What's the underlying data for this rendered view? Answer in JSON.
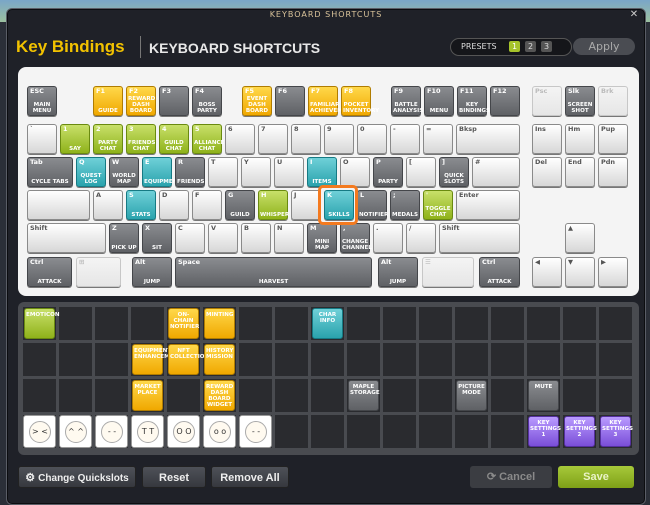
{
  "window": {
    "title": "KEYBOARD SHORTCUTS",
    "close": "✕"
  },
  "header": {
    "key_bindings": "Key Bindings",
    "keyboard_shortcuts": "KEYBOARD SHORTCUTS",
    "presets_label": "PRESETS",
    "presets": [
      "1",
      "2",
      "3"
    ],
    "active_preset": "1",
    "apply": "Apply"
  },
  "keys": [
    {
      "id": "esc",
      "label": "ESC",
      "action": "MAIN MENU",
      "color": "dark"
    },
    {
      "id": "f1",
      "label": "F1",
      "action": "GUIDE",
      "color": "yellow"
    },
    {
      "id": "f2",
      "label": "F2",
      "action": "REWARD DASH BOARD",
      "color": "yellow"
    },
    {
      "id": "f3",
      "label": "F3",
      "action": "",
      "color": "dark"
    },
    {
      "id": "f4",
      "label": "F4",
      "action": "BOSS PARTY",
      "color": "dark"
    },
    {
      "id": "f5",
      "label": "F5",
      "action": "EVENT DASH BOARD",
      "color": "yellow"
    },
    {
      "id": "f6",
      "label": "F6",
      "action": "",
      "color": "dark"
    },
    {
      "id": "f7",
      "label": "F7",
      "action": "FAMILIAR ACHIEVEMENT",
      "color": "yellow"
    },
    {
      "id": "f8",
      "label": "F8",
      "action": "POCKET INVENTORY",
      "color": "yellow"
    },
    {
      "id": "f9",
      "label": "F9",
      "action": "BATTLE ANALYSIS",
      "color": "dark"
    },
    {
      "id": "f10",
      "label": "F10",
      "action": "MENU",
      "color": "dark"
    },
    {
      "id": "f11",
      "label": "F11",
      "action": "KEY BINDINGS",
      "color": "dark"
    },
    {
      "id": "f12",
      "label": "F12",
      "action": "",
      "color": "dark"
    },
    {
      "id": "psc",
      "label": "Psc",
      "action": "",
      "color": "dimmed"
    },
    {
      "id": "slk",
      "label": "Slk",
      "action": "SCREEN SHOT",
      "color": "dark"
    },
    {
      "id": "brk",
      "label": "Brk",
      "action": "",
      "color": "dimmed"
    },
    {
      "id": "grave",
      "label": "`",
      "action": "",
      "color": "white"
    },
    {
      "id": "1",
      "label": "1",
      "action": "SAY",
      "color": "green"
    },
    {
      "id": "2",
      "label": "2",
      "action": "PARTY CHAT",
      "color": "green"
    },
    {
      "id": "3",
      "label": "3",
      "action": "FRIENDS CHAT",
      "color": "green"
    },
    {
      "id": "4",
      "label": "4",
      "action": "GUILD CHAT",
      "color": "green"
    },
    {
      "id": "5",
      "label": "5",
      "action": "ALLIANCE CHAT",
      "color": "green"
    },
    {
      "id": "6",
      "label": "6",
      "action": "",
      "color": "white"
    },
    {
      "id": "7",
      "label": "7",
      "action": "",
      "color": "white"
    },
    {
      "id": "8",
      "label": "8",
      "action": "",
      "color": "white"
    },
    {
      "id": "9",
      "label": "9",
      "action": "",
      "color": "white"
    },
    {
      "id": "0",
      "label": "0",
      "action": "",
      "color": "white"
    },
    {
      "id": "minus",
      "label": "-",
      "action": "",
      "color": "white"
    },
    {
      "id": "equal",
      "label": "=",
      "action": "",
      "color": "white"
    },
    {
      "id": "bksp",
      "label": "Bksp",
      "action": "",
      "color": "white"
    },
    {
      "id": "ins",
      "label": "Ins",
      "action": "",
      "color": "white"
    },
    {
      "id": "hm",
      "label": "Hm",
      "action": "",
      "color": "white"
    },
    {
      "id": "pup",
      "label": "Pup",
      "action": "",
      "color": "white"
    },
    {
      "id": "tab",
      "label": "Tab",
      "action": "CYCLE TABS",
      "color": "dark"
    },
    {
      "id": "q",
      "label": "Q",
      "action": "QUEST LOG",
      "color": "teal"
    },
    {
      "id": "w",
      "label": "W",
      "action": "WORLD MAP",
      "color": "dark"
    },
    {
      "id": "e",
      "label": "E",
      "action": "EQUIPMENT",
      "color": "teal"
    },
    {
      "id": "r",
      "label": "R",
      "action": "FRIENDS",
      "color": "dark"
    },
    {
      "id": "t",
      "label": "T",
      "action": "",
      "color": "white"
    },
    {
      "id": "y",
      "label": "Y",
      "action": "",
      "color": "white"
    },
    {
      "id": "u",
      "label": "U",
      "action": "",
      "color": "white"
    },
    {
      "id": "i",
      "label": "I",
      "action": "ITEMS",
      "color": "teal"
    },
    {
      "id": "o",
      "label": "O",
      "action": "",
      "color": "white"
    },
    {
      "id": "p",
      "label": "P",
      "action": "PARTY",
      "color": "dark"
    },
    {
      "id": "lbr",
      "label": "[",
      "action": "",
      "color": "white"
    },
    {
      "id": "rbr",
      "label": "]",
      "action": "QUICK SLOTS",
      "color": "dark"
    },
    {
      "id": "bsl",
      "label": "#",
      "action": "",
      "color": "white"
    },
    {
      "id": "del",
      "label": "Del",
      "action": "",
      "color": "white"
    },
    {
      "id": "end",
      "label": "End",
      "action": "",
      "color": "white"
    },
    {
      "id": "pdn",
      "label": "Pdn",
      "action": "",
      "color": "white"
    },
    {
      "id": "caps",
      "label": "",
      "action": "",
      "color": "white"
    },
    {
      "id": "a",
      "label": "A",
      "action": "",
      "color": "white"
    },
    {
      "id": "s",
      "label": "S",
      "action": "STATS",
      "color": "teal"
    },
    {
      "id": "d",
      "label": "D",
      "action": "",
      "color": "white"
    },
    {
      "id": "f",
      "label": "F",
      "action": "",
      "color": "white"
    },
    {
      "id": "g",
      "label": "G",
      "action": "GUILD",
      "color": "dark"
    },
    {
      "id": "h",
      "label": "H",
      "action": "WHISPER",
      "color": "green"
    },
    {
      "id": "j",
      "label": "J",
      "action": "",
      "color": "white"
    },
    {
      "id": "k",
      "label": "K",
      "action": "SKILLS",
      "color": "teal"
    },
    {
      "id": "l",
      "label": "L",
      "action": "NOTIFIER",
      "color": "dark"
    },
    {
      "id": "semi",
      "label": ";",
      "action": "MEDALS",
      "color": "dark"
    },
    {
      "id": "quote",
      "label": "'",
      "action": "TOGGLE CHAT",
      "color": "green"
    },
    {
      "id": "enter",
      "label": "Enter",
      "action": "",
      "color": "white"
    },
    {
      "id": "lshift",
      "label": "Shift",
      "action": "",
      "color": "white"
    },
    {
      "id": "z",
      "label": "Z",
      "action": "PICK UP",
      "color": "dark"
    },
    {
      "id": "x",
      "label": "X",
      "action": "SIT",
      "color": "dark"
    },
    {
      "id": "c",
      "label": "C",
      "action": "",
      "color": "white"
    },
    {
      "id": "v",
      "label": "V",
      "action": "",
      "color": "white"
    },
    {
      "id": "b",
      "label": "B",
      "action": "",
      "color": "white"
    },
    {
      "id": "n",
      "label": "N",
      "action": "",
      "color": "white"
    },
    {
      "id": "m",
      "label": "M",
      "action": "MINI MAP",
      "color": "dark"
    },
    {
      "id": "comma",
      "label": ",",
      "action": "CHANGE CHANNEL",
      "color": "dark"
    },
    {
      "id": "period",
      "label": ".",
      "action": "",
      "color": "white"
    },
    {
      "id": "slash",
      "label": "/",
      "action": "",
      "color": "white"
    },
    {
      "id": "rshift",
      "label": "Shift",
      "action": "",
      "color": "white"
    },
    {
      "id": "up",
      "label": "▲",
      "action": "",
      "color": "white"
    },
    {
      "id": "lctrl",
      "label": "Ctrl",
      "action": "ATTACK",
      "color": "dark"
    },
    {
      "id": "win",
      "label": "⊞",
      "action": "",
      "color": "dimmed"
    },
    {
      "id": "lalt",
      "label": "Alt",
      "action": "JUMP",
      "color": "dark"
    },
    {
      "id": "space",
      "label": "Space",
      "action": "HARVEST",
      "color": "dark"
    },
    {
      "id": "ralt",
      "label": "Alt",
      "action": "JUMP",
      "color": "dark"
    },
    {
      "id": "menu",
      "label": "☰",
      "action": "",
      "color": "dimmed"
    },
    {
      "id": "rctrl",
      "label": "Ctrl",
      "action": "ATTACK",
      "color": "dark"
    },
    {
      "id": "left",
      "label": "◀",
      "action": "",
      "color": "white"
    },
    {
      "id": "down",
      "label": "▼",
      "action": "",
      "color": "white"
    },
    {
      "id": "right",
      "label": "▶",
      "action": "",
      "color": "white"
    }
  ],
  "slots": [
    {
      "action": "EMOTICON",
      "color": "green"
    },
    {
      "action": "ON-CHAIN NOTIFIER",
      "color": "yellow"
    },
    {
      "action": "MINTING",
      "color": "yellow"
    },
    {
      "action": "CHAR INFO",
      "color": "teal"
    },
    {
      "action": "EQUIPMENT ENHANCEMENT",
      "color": "yellow"
    },
    {
      "action": "NFT COLLECTION",
      "color": "yellow"
    },
    {
      "action": "HISTORY MISSION",
      "color": "yellow"
    },
    {
      "action": "MARKET PLACE",
      "color": "yellow"
    },
    {
      "action": "REWARD DASH BOARD WIDGET",
      "color": "yellow"
    },
    {
      "action": "MAPLE STORAGE",
      "color": "dark"
    },
    {
      "action": "PICTURE MODE",
      "color": "dark"
    },
    {
      "action": "MUTE",
      "color": "dark"
    },
    {
      "action": "KEY SETTINGS 1",
      "color": "purple"
    },
    {
      "action": "KEY SETTINGS 2",
      "color": "purple"
    },
    {
      "action": "KEY SETTINGS 3",
      "color": "purple"
    }
  ],
  "emotes": [
    "> <",
    "^ ^",
    "- -",
    "T T",
    "O O",
    "o o",
    "- -"
  ],
  "footer": {
    "change_quickslots": "Change Quickslots",
    "reset": "Reset",
    "remove_all": "Remove All",
    "cancel": "Cancel",
    "save": "Save"
  },
  "colors": {
    "accent": "#f2c200",
    "highlight": "#f47a1f",
    "save": "#8fb21a"
  }
}
